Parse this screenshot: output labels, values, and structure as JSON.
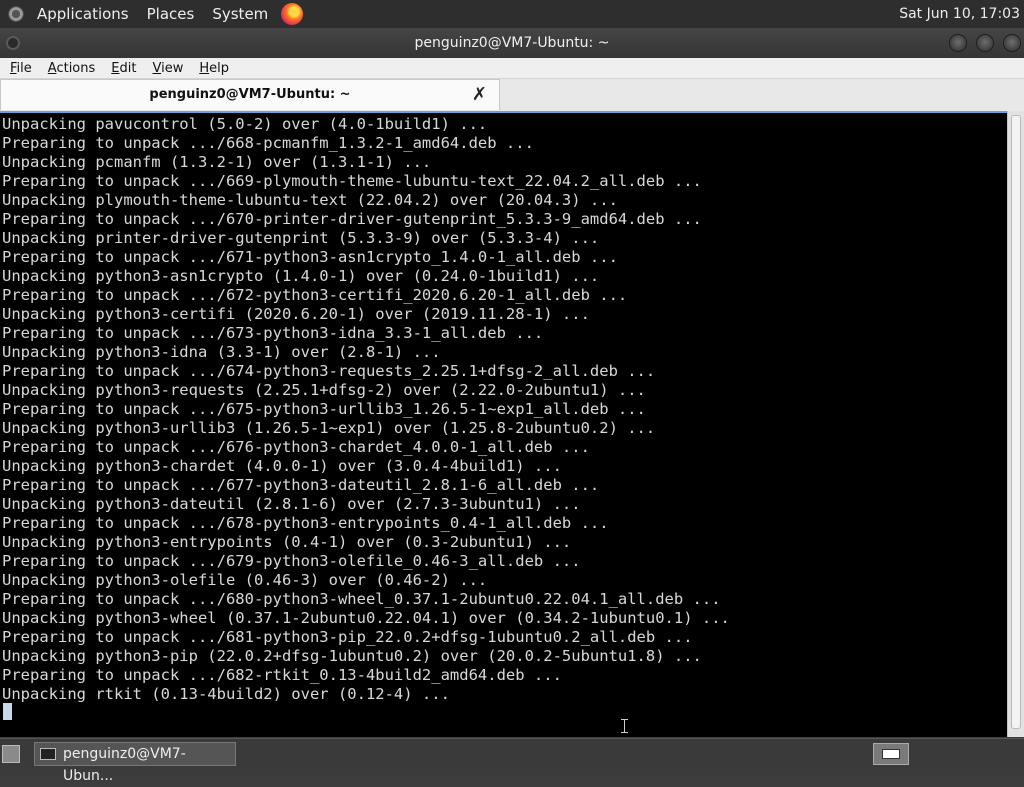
{
  "top_panel": {
    "menus": [
      "Applications",
      "Places",
      "System"
    ],
    "clock": "Sat Jun 10, 17:03"
  },
  "window": {
    "title": "penguinz0@VM7-Ubuntu: ~"
  },
  "menubar": {
    "items": [
      {
        "u": "F",
        "rest": "ile"
      },
      {
        "u": "A",
        "rest": "ctions"
      },
      {
        "u": "E",
        "rest": "dit"
      },
      {
        "u": "V",
        "rest": "iew"
      },
      {
        "u": "H",
        "rest": "elp"
      }
    ]
  },
  "tab": {
    "label": "penguinz0@VM7-Ubuntu: ~",
    "close_glyph": "✗"
  },
  "terminal": {
    "lines": [
      "Unpacking pavucontrol (5.0-2) over (4.0-1build1) ...",
      "Preparing to unpack .../668-pcmanfm_1.3.2-1_amd64.deb ...",
      "Unpacking pcmanfm (1.3.2-1) over (1.3.1-1) ...",
      "Preparing to unpack .../669-plymouth-theme-lubuntu-text_22.04.2_all.deb ...",
      "Unpacking plymouth-theme-lubuntu-text (22.04.2) over (20.04.3) ...",
      "Preparing to unpack .../670-printer-driver-gutenprint_5.3.3-9_amd64.deb ...",
      "Unpacking printer-driver-gutenprint (5.3.3-9) over (5.3.3-4) ...",
      "Preparing to unpack .../671-python3-asn1crypto_1.4.0-1_all.deb ...",
      "Unpacking python3-asn1crypto (1.4.0-1) over (0.24.0-1build1) ...",
      "Preparing to unpack .../672-python3-certifi_2020.6.20-1_all.deb ...",
      "Unpacking python3-certifi (2020.6.20-1) over (2019.11.28-1) ...",
      "Preparing to unpack .../673-python3-idna_3.3-1_all.deb ...",
      "Unpacking python3-idna (3.3-1) over (2.8-1) ...",
      "Preparing to unpack .../674-python3-requests_2.25.1+dfsg-2_all.deb ...",
      "Unpacking python3-requests (2.25.1+dfsg-2) over (2.22.0-2ubuntu1) ...",
      "Preparing to unpack .../675-python3-urllib3_1.26.5-1~exp1_all.deb ...",
      "Unpacking python3-urllib3 (1.26.5-1~exp1) over (1.25.8-2ubuntu0.2) ...",
      "Preparing to unpack .../676-python3-chardet_4.0.0-1_all.deb ...",
      "Unpacking python3-chardet (4.0.0-1) over (3.0.4-4build1) ...",
      "Preparing to unpack .../677-python3-dateutil_2.8.1-6_all.deb ...",
      "Unpacking python3-dateutil (2.8.1-6) over (2.7.3-3ubuntu1) ...",
      "Preparing to unpack .../678-python3-entrypoints_0.4-1_all.deb ...",
      "Unpacking python3-entrypoints (0.4-1) over (0.3-2ubuntu1) ...",
      "Preparing to unpack .../679-python3-olefile_0.46-3_all.deb ...",
      "Unpacking python3-olefile (0.46-3) over (0.46-2) ...",
      "Preparing to unpack .../680-python3-wheel_0.37.1-2ubuntu0.22.04.1_all.deb ...",
      "Unpacking python3-wheel (0.37.1-2ubuntu0.22.04.1) over (0.34.2-1ubuntu0.1) ...",
      "Preparing to unpack .../681-python3-pip_22.0.2+dfsg-1ubuntu0.2_all.deb ...",
      "Unpacking python3-pip (22.0.2+dfsg-1ubuntu0.2) over (20.0.2-5ubuntu1.8) ...",
      "Preparing to unpack .../682-rtkit_0.13-4build2_amd64.deb ...",
      "Unpacking rtkit (0.13-4build2) over (0.12-4) ..."
    ]
  },
  "taskbar": {
    "task_label": "penguinz0@VM7-Ubun..."
  },
  "icons": {
    "top_logo": "distro-logo-icon",
    "browser": "firefox-icon",
    "terminal_window": "terminal-window-icon",
    "desktop": "show-desktop-icon",
    "workspace": "workspace-switcher-icon"
  }
}
